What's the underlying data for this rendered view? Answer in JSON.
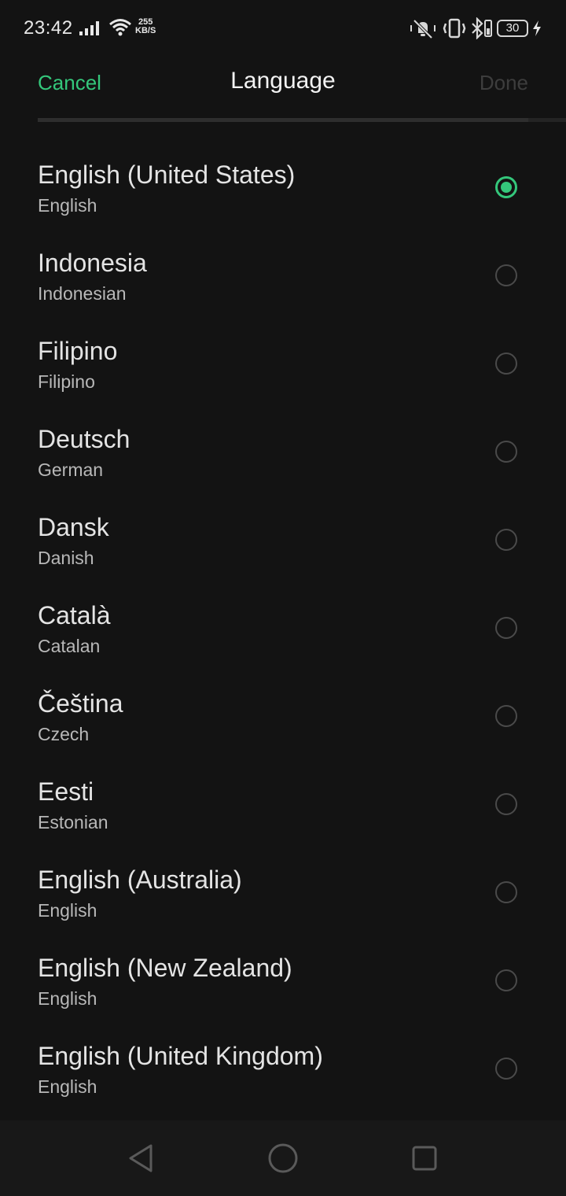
{
  "status_bar": {
    "time": "23:42",
    "net_speed_value": "255",
    "net_speed_unit": "KB/S",
    "battery_level": "30",
    "icons": [
      "signal-icon",
      "wifi-icon",
      "mute-icon",
      "vibrate-icon",
      "bluetooth-icon",
      "battery-icon",
      "charging-icon"
    ]
  },
  "header": {
    "cancel_label": "Cancel",
    "title": "Language",
    "done_label": "Done"
  },
  "colors": {
    "accent": "#34c77b",
    "background": "#131313",
    "disabled": "#3d3d3d"
  },
  "languages": [
    {
      "native": "English (United States)",
      "english": "English",
      "selected": true
    },
    {
      "native": "Indonesia",
      "english": "Indonesian",
      "selected": false
    },
    {
      "native": "Filipino",
      "english": "Filipino",
      "selected": false
    },
    {
      "native": "Deutsch",
      "english": "German",
      "selected": false
    },
    {
      "native": "Dansk",
      "english": "Danish",
      "selected": false
    },
    {
      "native": "Català",
      "english": "Catalan",
      "selected": false
    },
    {
      "native": "Čeština",
      "english": "Czech",
      "selected": false
    },
    {
      "native": "Eesti",
      "english": "Estonian",
      "selected": false
    },
    {
      "native": "English (Australia)",
      "english": "English",
      "selected": false
    },
    {
      "native": "English (New Zealand)",
      "english": "English",
      "selected": false
    },
    {
      "native": "English (United Kingdom)",
      "english": "English",
      "selected": false
    }
  ],
  "nav_bar": {
    "icons": [
      "back-icon",
      "home-icon",
      "recents-icon"
    ]
  }
}
